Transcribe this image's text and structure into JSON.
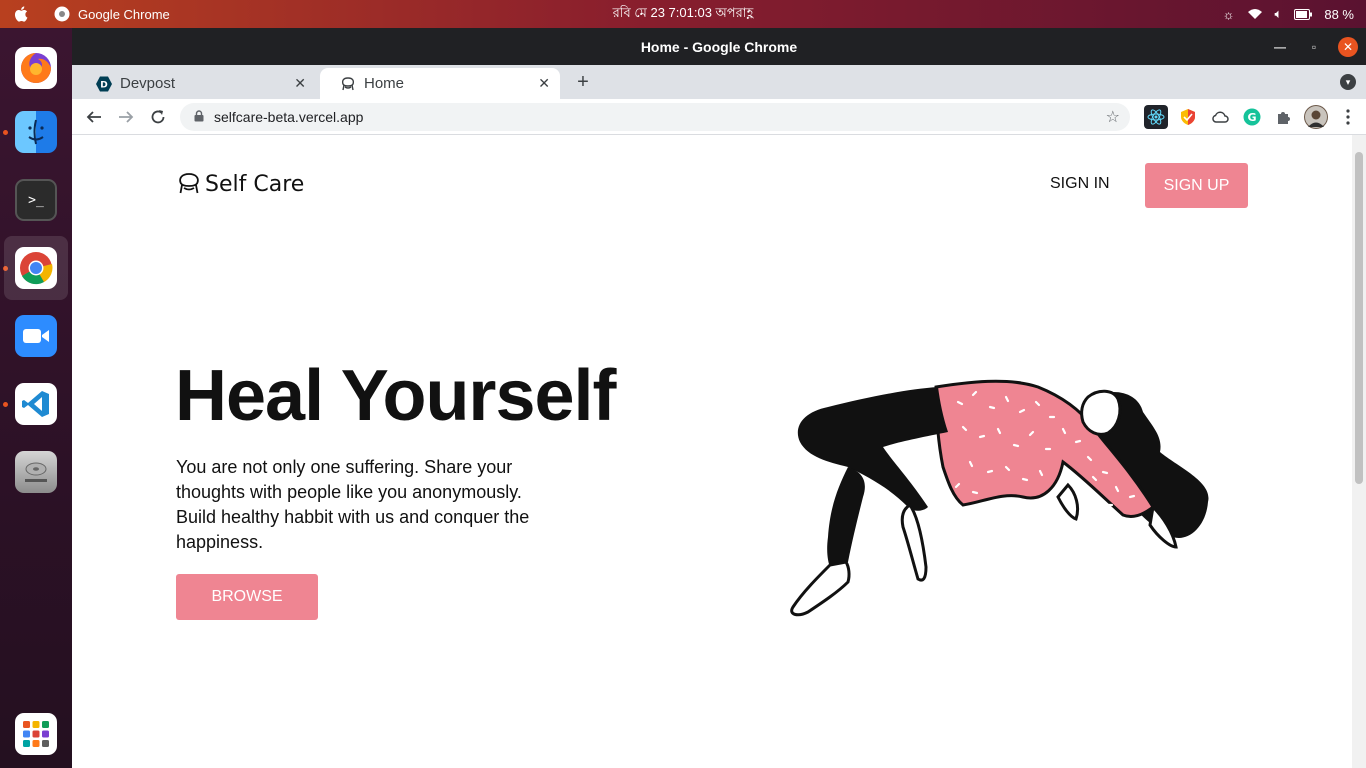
{
  "system": {
    "app_name": "Google Chrome",
    "clock": "রবি মে 23   7:01:03 অপরাহ্ণ",
    "battery": "88 %"
  },
  "window": {
    "title": "Home - Google Chrome"
  },
  "tabs": [
    {
      "label": "Devpost",
      "icon": "devpost-icon"
    },
    {
      "label": "Home",
      "icon": "selfcare-icon"
    }
  ],
  "address_bar": {
    "url": "selfcare-beta.vercel.app"
  },
  "page": {
    "logo_text": "Self Care",
    "nav": {
      "signin_label": "SIGN IN",
      "signup_label": "SIGN UP"
    },
    "hero": {
      "title": "Heal Yourself",
      "text": "You are not only one suffering. Share your thoughts with people like you anonymously. Build healthy habbit with us and conquer the happiness.",
      "button_label": "BROWSE"
    }
  },
  "colors": {
    "accent_pink": "#ef8592",
    "ubuntu_orange": "#e95420"
  }
}
